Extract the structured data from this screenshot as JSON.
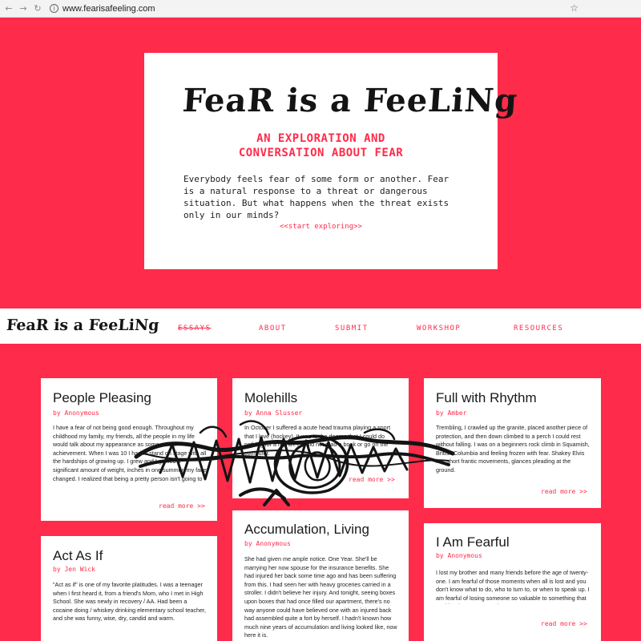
{
  "browser": {
    "url": "www.fearisafeeling.com",
    "back_icon": "arrow-left-icon",
    "forward_icon": "arrow-right-icon",
    "reload_icon": "reload-icon",
    "info_icon": "info-icon",
    "bookmark_icon": "star-icon"
  },
  "hero": {
    "logo_text": "FeaR is a FeeLiNg",
    "subtitle_line1": "AN EXPLORATION AND",
    "subtitle_line2": "CONVERSATION ABOUT FEAR",
    "body": "Everybody feels fear of some form or another. Fear is a natural response to a threat or dangerous situation. But what happens when the threat exists only in our minds?",
    "cta": "<<start exploring>>"
  },
  "nav": {
    "logo_text": "FeaR is a FeeLiNg",
    "links": [
      "ESSAYS",
      "ABOUT",
      "SUBMIT",
      "WORKSHOP",
      "RESOURCES"
    ]
  },
  "essays": [
    {
      "title": "People Pleasing",
      "author": "by Anonymous",
      "excerpt": "I have a fear of not being good enough. Throughout my childhood my family, my friends, all the people in my life would talk about my appearance as some sort of achievement. When I was 10 I had to stand on stage with all the hardships of growing up. I grew and I gained a significant amount of weight, inches in one summer, my face changed. I realized that being a pretty person isn't going to get me anywhere.",
      "more": "read more >>"
    },
    {
      "title": "Molehills",
      "author": "by Anna Slusser",
      "excerpt": "In October I suffered a acute head trauma playing a sport that I love (hockey). It was to the degree that I could do nothing for a month. I could not read a book or go on the computer.",
      "more": "read more >>"
    },
    {
      "title": "Full with Rhythm",
      "author": "by Amber",
      "excerpt": "Trembling, I crawled up the granite, placed another piece of protection, and then down climbed to a perch I could rest without falling. I was on a beginners rock climb in Squamish, British Columbia and feeling frozen with fear. Shakey Elvis leg, short frantic movements, glances pleading at the ground.",
      "more": "read more >>"
    },
    {
      "title": "Act As If",
      "author": "by Jen Wick",
      "excerpt": "\"Act as if\" is one of my favorite platitudes. I was a teenager when I first heard it, from a friend's Mom, who I met in High School. She was newly in recovery / AA. Had been a cocaine doing / whiskey drinking elementary school teacher, and she was funny, wise, dry, candid and warm.",
      "more": ""
    },
    {
      "title": "Accumulation, Living",
      "author": "by Anonymous",
      "excerpt": "She had given me ample notice. One Year. She'll be marrying her now spouse for the insurance benefits. She had injured her back some time ago and has been suffering from this. I had seen her with heavy groceries carried in a stroller. I didn't believe her injury. And tonight, seeing boxes upon boxes that had once filled our apartment, there's no way anyone could have believed one with an injured back had assembled quite a fort by herself. I hadn't known how much nine years of accumulation and living looked like, now here it is.",
      "more": ""
    },
    {
      "title": "I Am Fearful",
      "author": "by Anonymous",
      "excerpt": "I lost my brother and many friends before the age of twenty-one. I am fearful of those moments when all is lost and you don't know what to do, who to turn to, or when to speak up. I am fearful of losing someone so valuable to something that could've been prevented.",
      "more": "read more >>"
    }
  ]
}
